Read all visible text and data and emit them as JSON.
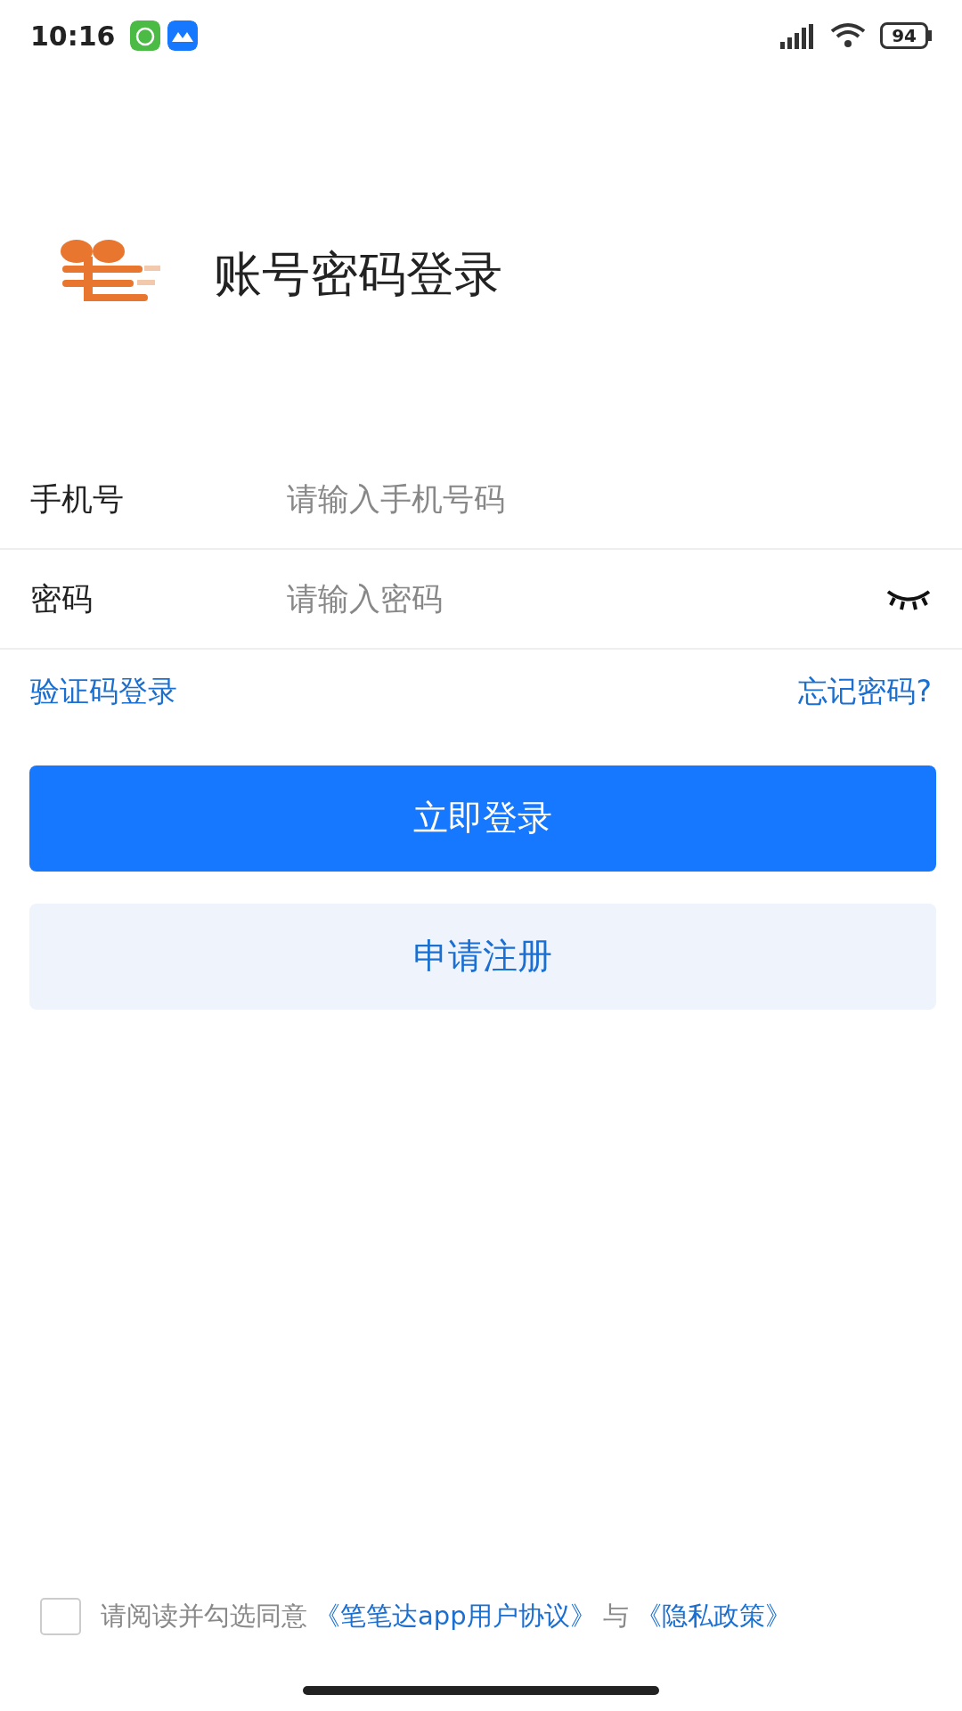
{
  "status_bar": {
    "time": "10:16",
    "battery": "94"
  },
  "title": "账号密码登录",
  "fields": [
    {
      "label": "手机号",
      "placeholder": "请输入手机号码",
      "kind": "phone"
    },
    {
      "label": "密码",
      "placeholder": "请输入密码",
      "kind": "password"
    }
  ],
  "links": {
    "left": "验证码登录",
    "right": "忘记密码?"
  },
  "buttons": [
    {
      "label": "立即登录",
      "kind": "primary"
    },
    {
      "label": "申请注册",
      "kind": "secondary"
    }
  ],
  "agreement": {
    "checked": false,
    "parts": [
      {
        "text": "请阅读并勾选同意",
        "kind": "text"
      },
      {
        "text": "《笔笔达app用户协议》",
        "kind": "link"
      },
      {
        "text": "与",
        "kind": "text"
      },
      {
        "text": "《隐私政策》",
        "kind": "link"
      }
    ]
  }
}
